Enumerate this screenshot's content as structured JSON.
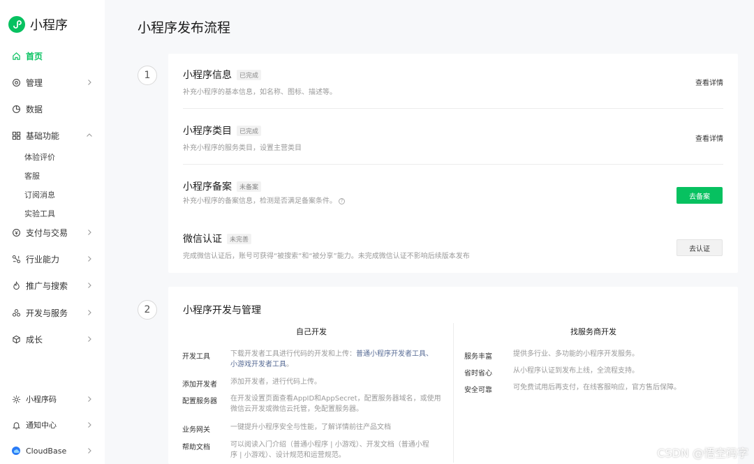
{
  "brand": {
    "name": "小程序"
  },
  "sidebar": {
    "items": [
      {
        "label": "首页",
        "icon": "home-icon"
      },
      {
        "label": "管理",
        "icon": "settings-icon"
      },
      {
        "label": "数据",
        "icon": "chart-pie-icon"
      },
      {
        "label": "基础功能",
        "icon": "grid-icon"
      },
      {
        "label": "支付与交易",
        "icon": "coin-icon"
      },
      {
        "label": "行业能力",
        "icon": "network-icon"
      },
      {
        "label": "推广与搜索",
        "icon": "flame-icon"
      },
      {
        "label": "开发与服务",
        "icon": "cluster-icon"
      },
      {
        "label": "成长",
        "icon": "cube-icon"
      }
    ],
    "sub_items": [
      "体验评价",
      "客服",
      "订阅消息",
      "实验工具"
    ],
    "bottom": [
      {
        "label": "小程序码",
        "icon": "sun-icon"
      },
      {
        "label": "通知中心",
        "icon": "bell-icon"
      },
      {
        "label": "CloudBase",
        "icon": "cloudbase-icon"
      }
    ]
  },
  "page": {
    "title": "小程序发布流程"
  },
  "steps": [
    "1",
    "2"
  ],
  "section1": {
    "rows": [
      {
        "title": "小程序信息",
        "badge": "已完成",
        "desc": "补充小程序的基本信息，如名称、图标、描述等。",
        "action": "查看详情"
      },
      {
        "title": "小程序类目",
        "badge": "已完成",
        "desc": "补充小程序的服务类目，设置主营类目",
        "action": "查看详情"
      },
      {
        "title": "小程序备案",
        "badge": "未备案",
        "desc": "补充小程序的备案信息，检测是否满足备案条件。",
        "action": "去备案"
      },
      {
        "title": "微信认证",
        "badge": "未完善",
        "desc": "完成微信认证后，账号可获得“被搜索”和“被分享”能力。未完成微信认证不影响后续版本发布",
        "action": "去认证"
      }
    ]
  },
  "section2": {
    "title": "小程序开发与管理",
    "left_head": "自己开发",
    "right_head": "找服务商开发",
    "left": [
      {
        "name": "开发工具",
        "desc1": "下载开发者工具进行代码的开发和上传：",
        "link1": "普通小程序开发者工具、",
        "desc2": "",
        "link2": "小游戏开发者工具",
        "desc3": "。"
      },
      {
        "name": "添加开发者",
        "desc1": "添加开发者，进行代码上传。"
      },
      {
        "name": "配置服务器",
        "line1": "在开发设置页面查看AppID和AppSecret，配置服务器域名，或使用",
        "line2": "微信云开发或微信云托管，免配置服务器。"
      },
      {
        "name": "业务网关",
        "desc1": "一键提升小程序安全与性能，了解详情前往产品文档"
      },
      {
        "name": "帮助文档",
        "line1": "可以阅读入门介绍（普通小程序 | 小游戏）、开发文档（普通小程",
        "line2": "序 | 小游戏）、设计规范和运营规范。"
      }
    ],
    "right": [
      {
        "name": "服务丰富",
        "desc": "提供多行业、多功能的小程序开发服务。"
      },
      {
        "name": "省时省心",
        "desc": "从小程序认证到发布上线，全流程支持。"
      },
      {
        "name": "安全可靠",
        "desc": "可免费试用后再支付，在线客服响应，官方售后保障。"
      }
    ]
  },
  "watermark": "CSDN @悟空码字",
  "colors": {
    "brand": "#07c160",
    "link": "#576b95"
  }
}
